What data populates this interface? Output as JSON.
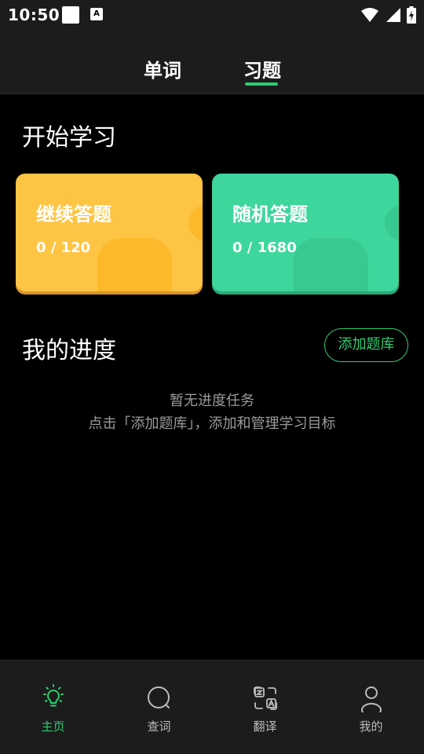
{
  "status_bar": {
    "time": "10:50",
    "notif_letter": "A"
  },
  "tabs": [
    {
      "label": "单词"
    },
    {
      "label": "习题"
    }
  ],
  "start": {
    "title": "开始学习",
    "cards": [
      {
        "title": "继续答题",
        "count": "0 / 120"
      },
      {
        "title": "随机答题",
        "count": "0 / 1680"
      }
    ]
  },
  "progress": {
    "title": "我的进度",
    "add_button": "添加题库",
    "empty_line1": "暂无进度任务",
    "empty_line2": "点击「添加题库」，添加和管理学习目标"
  },
  "bottom_nav": [
    {
      "label": "主页",
      "icon": "lightbulb-icon"
    },
    {
      "label": "查词",
      "icon": "search-icon"
    },
    {
      "label": "翻译",
      "icon": "translate-icon"
    },
    {
      "label": "我的",
      "icon": "profile-icon"
    }
  ],
  "colors": {
    "accent": "#2ecc71",
    "card_yellow": "#fec443",
    "card_green": "#3dd69c",
    "bg": "#000000",
    "bar": "#1c1c1c"
  }
}
